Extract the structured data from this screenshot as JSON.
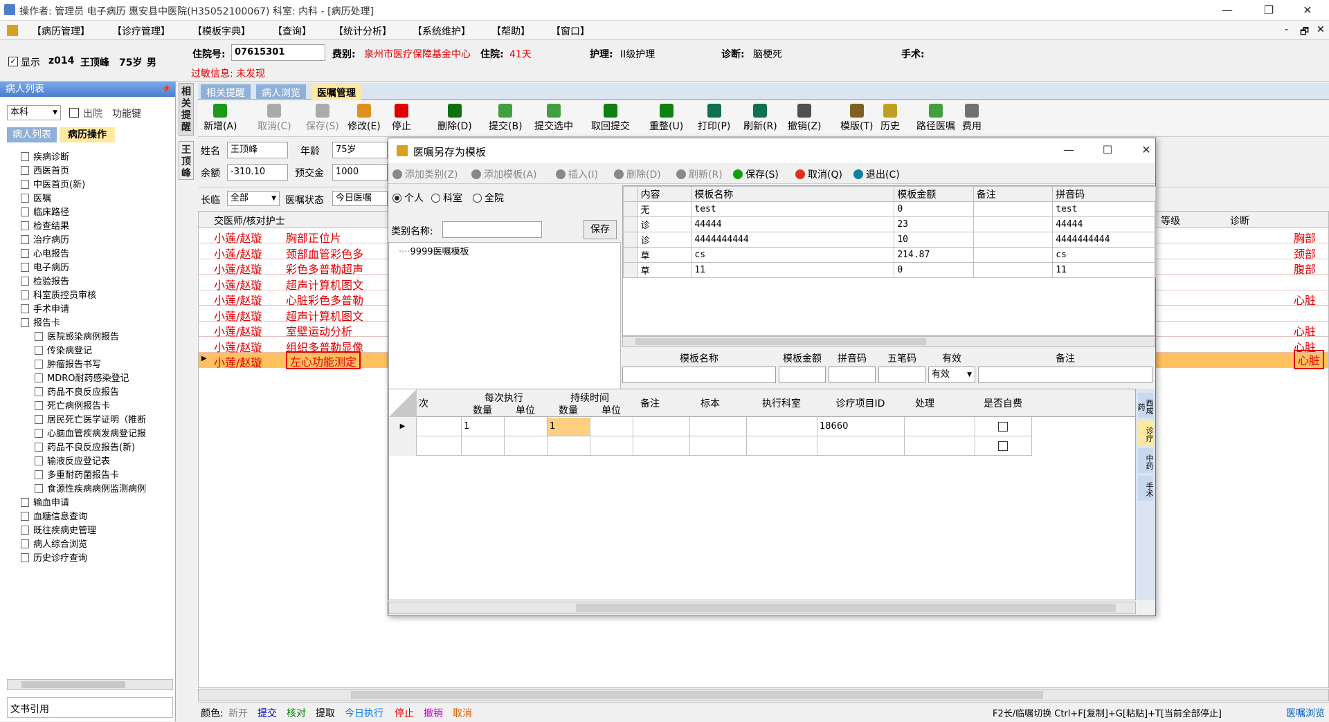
{
  "window": {
    "title": "操作者: 管理员 电子病历  惠安县中医院(H35052100067)  科室: 内科 - [病历处理]",
    "min": "—",
    "max": "❐",
    "close": "✕"
  },
  "menu": [
    "【病历管理】",
    "【诊疗管理】",
    "【模板字典】",
    "【查询】",
    "【统计分析】",
    "【系统维护】",
    "【帮助】",
    "【窗口】"
  ],
  "mdi": {
    "min": "-",
    "restore": "🗗",
    "close": "✕"
  },
  "patient": {
    "show_label": "显示",
    "bed": "z014",
    "name": "王顶峰",
    "age": "75岁",
    "sex": "男",
    "inpatient_label": "住院号:",
    "inpatient_no": "07615301",
    "fee_label": "费别:",
    "fee_value": "泉州市医疗保障基金中心",
    "stay_label": "住院:",
    "stay_value": "41天",
    "nursing_label": "护理:",
    "nursing_value": "II级护理",
    "diag_label": "诊断:",
    "diag_value": "脑梗死",
    "surgery_label": "手术:",
    "allergy": "过敏信息: 未发现"
  },
  "left": {
    "header": "病人列表",
    "pin": "📌",
    "dept": "本科",
    "discharge": "出院",
    "func": "功能键",
    "tab1": "病人列表",
    "tab2": "病历操作",
    "tree": [
      "疾病诊断",
      "西医首页",
      "中医首页(新)",
      "医嘱",
      "临床路径",
      "检查结果",
      "治疗病历",
      "心电报告",
      "电子病历",
      "检验报告",
      "科室质控员审核",
      "手术申请",
      "报告卡",
      "医院感染病例报告",
      "传染病登记",
      "肿瘤报告书写",
      "MDRO耐药感染登记",
      "药品不良反应报告",
      "死亡病例报告卡",
      "居民死亡医学证明（推断",
      "心脑血管疾病发病登记报",
      "药品不良反应报告(新)",
      "输液反应登记表",
      "多重耐药菌报告卡",
      "食源性疾病病例监测病例",
      "输血申请",
      "血糖信息查询",
      "既往疾病史管理",
      "病人综合浏览",
      "历史诊疗查询"
    ],
    "footer": "文书引用"
  },
  "sidetabs": {
    "a": "相关提醒",
    "b": "王顶峰"
  },
  "tabs": [
    "相关提醒",
    "病人浏览",
    "医嘱管理"
  ],
  "toolbar": [
    "新增(A)",
    "取消(C)",
    "保存(S)",
    "修改(E)",
    "停止",
    "删除(D)",
    "提交(B)",
    "提交选中",
    "取回提交",
    "重整(U)",
    "打印(P)",
    "刷新(R)",
    "撤销(Z)",
    "模版(T)",
    "历史",
    "路径医嘱",
    "费用"
  ],
  "form": {
    "name_label": "姓名",
    "name": "王顶峰",
    "age_label": "年龄",
    "age": "75岁",
    "balance_label": "余额",
    "balance": "-310.10",
    "prepay_label": "预交金",
    "prepay": "1000",
    "long_label": "长临",
    "long_val": "全部",
    "status_label": "医嘱状态",
    "status_val": "今日医嘱"
  },
  "orders": {
    "header_left": "交医师/核对护士",
    "header_level": "等级",
    "header_diag": "诊断",
    "doctors": [
      "小莲/赵璇",
      "小莲/赵璇",
      "小莲/赵璇",
      "小莲/赵璇",
      "小莲/赵璇",
      "小莲/赵璇",
      "小莲/赵璇",
      "小莲/赵璇",
      "小莲/赵璇"
    ],
    "items": [
      "胸部正位片",
      "颈部血管彩色多",
      "彩色多普勒超声",
      "超声计算机图文",
      "心脏彩色多普勒",
      "超声计算机图文",
      "室壁运动分析",
      "组织多普勒显像",
      "左心功能测定"
    ],
    "right": [
      "胸部",
      "颈部",
      "腹部",
      "",
      "心脏",
      "",
      "心脏",
      "心脏",
      "心脏"
    ]
  },
  "dialog": {
    "title": "医嘱另存为模板",
    "min": "—",
    "max": "☐",
    "close": "✕",
    "tools": [
      "添加类别(Z)",
      "添加模板(A)",
      "插入(I)",
      "删除(D)",
      "刷新(R)",
      "保存(S)",
      "取消(Q)",
      "退出(C)"
    ],
    "radios": [
      "个人",
      "科室",
      "全院"
    ],
    "cat_label": "类别名称:",
    "save_btn": "保存",
    "tree_item": "9999医嘱模板",
    "tpl_headers": [
      "内容",
      "模板名称",
      "模板金额",
      "备注",
      "拼音码"
    ],
    "tpl_rows": [
      [
        "无",
        "test",
        "0",
        "",
        "test"
      ],
      [
        "诊",
        "44444",
        "23",
        "",
        "44444"
      ],
      [
        "诊",
        "4444444444",
        "10",
        "",
        "4444444444"
      ],
      [
        "草",
        "cs",
        "214.87",
        "",
        "cs"
      ],
      [
        "草",
        "11",
        "0",
        "",
        "11"
      ]
    ],
    "edit_headers": [
      "模板名称",
      "模板金额",
      "拼音码",
      "五笔码",
      "有效",
      "备注"
    ],
    "valid_val": "有效",
    "detail_headers": {
      "c1": "次",
      "g1": "每次执行",
      "g2": "持续时间",
      "qty": "数量",
      "unit": "单位",
      "note": "备注",
      "mark": "标本",
      "dept": "执行科室",
      "itemid": "诊疗项目ID",
      "handle": "处理",
      "self": "是否自费"
    },
    "detail_row": {
      "qty1": "1",
      "qty2": "1",
      "itemid": "18660"
    },
    "vtabs": [
      "西成药",
      "诊疗",
      "中药",
      "手术"
    ]
  },
  "status": {
    "color_label": "颜色:",
    "items": [
      "新开",
      "提交",
      "核对",
      "提取",
      "今日执行",
      "停止",
      "撤销",
      "取消"
    ],
    "colors": [
      "#888888",
      "#0000cc",
      "#008000",
      "#000000",
      "#0080ff",
      "#e00000",
      "#cc00cc",
      "#e06000"
    ],
    "hint": "F2长/临嘱切换 Ctrl+F[复制]+G[粘贴]+T[当前全部停止]",
    "link": "医嘱浏览"
  }
}
